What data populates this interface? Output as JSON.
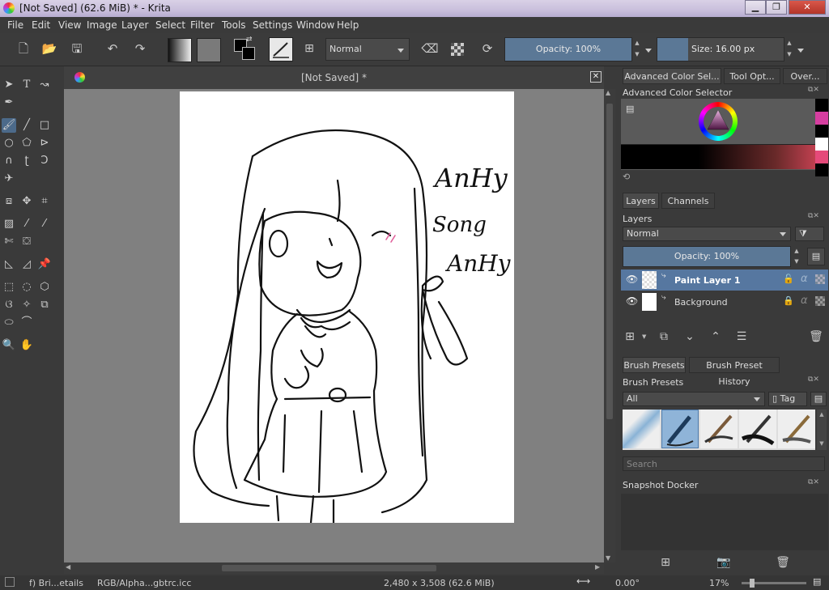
{
  "window": {
    "title": "[Not Saved]  (62.6 MiB)  * - Krita",
    "minimize": "▁",
    "maximize": "❐",
    "close": "✕"
  },
  "menu": [
    "File",
    "Edit",
    "View",
    "Image",
    "Layer",
    "Select",
    "Filter",
    "Tools",
    "Settings",
    "Window",
    "Help"
  ],
  "toolbar": {
    "blend_mode": "Normal",
    "opacity_label": "Opacity: 100%",
    "size_label": "Size: 16.00 px"
  },
  "canvas": {
    "doc_title": "[Not Saved]  *",
    "sketch_text": [
      "AnHy",
      "Song",
      "AnHy"
    ]
  },
  "color_docker": {
    "tabs": [
      "Advanced Color Sel...",
      "Tool Opt...",
      "Over..."
    ],
    "title": "Advanced Color Selector",
    "swatches": [
      "#000000",
      "#d63ea0",
      "#000000",
      "#ffffff",
      "#e54a7a",
      "#000000"
    ]
  },
  "layers_docker": {
    "tabs": [
      "Layers",
      "Channels"
    ],
    "title": "Layers",
    "blend_mode": "Normal",
    "opacity_label": "Opacity:  100%",
    "layers": [
      {
        "name": "Paint Layer 1",
        "selected": true
      },
      {
        "name": "Background",
        "selected": false
      }
    ]
  },
  "brush_docker": {
    "tabs": [
      "Brush Presets",
      "Brush Preset History"
    ],
    "title": "Brush Presets",
    "filter": "All",
    "tag_label": "Tag",
    "search_placeholder": "Search"
  },
  "snapshot_docker": {
    "title": "Snapshot Docker"
  },
  "status": {
    "brush": "f) Bri...etails",
    "color_space": "RGB/Alpha...gbtrc.icc",
    "dimensions": "2,480 x 3,508 (62.6 MiB)",
    "rotation": "0.00°",
    "zoom": "17%"
  },
  "colors": {
    "accent": "#5b7896",
    "selected_row": "#5677a0",
    "panel": "#3a3a3a",
    "canvas_bg": "#808080"
  }
}
